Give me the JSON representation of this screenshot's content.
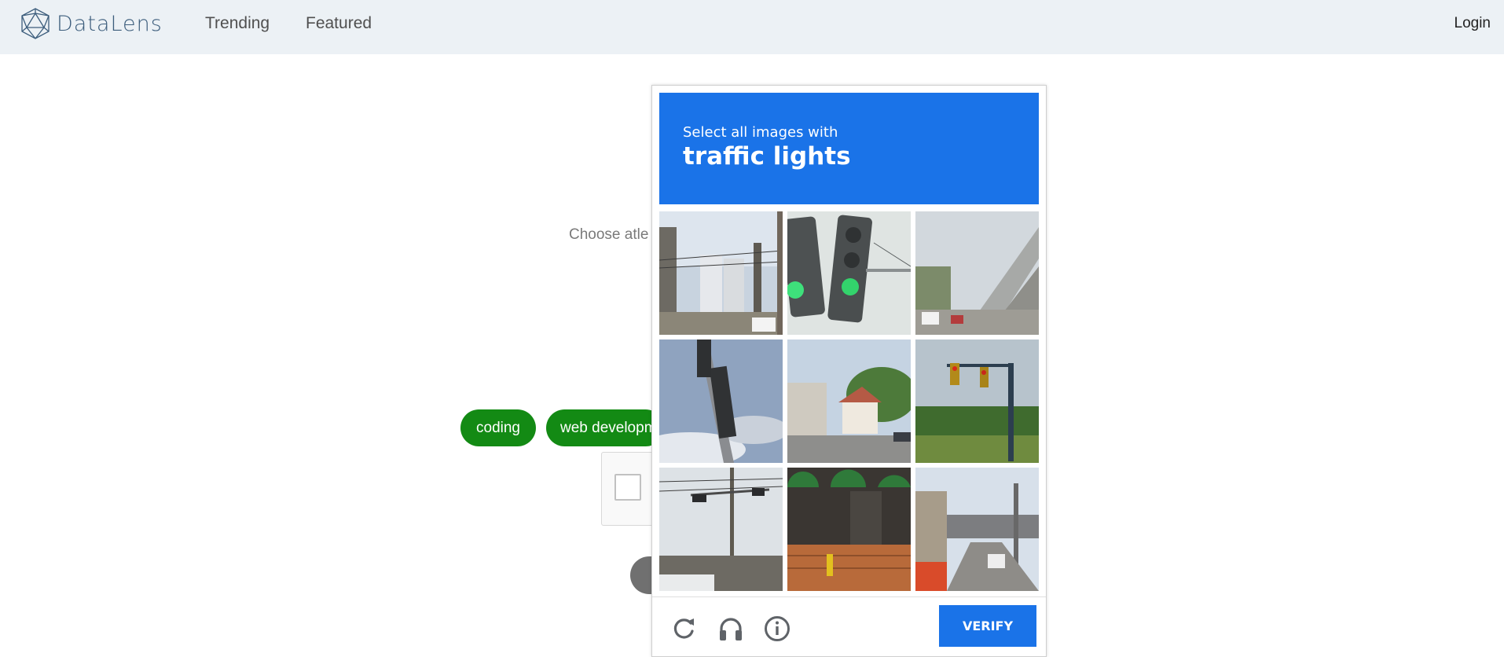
{
  "navbar": {
    "brand": "DataLens",
    "links": [
      "Trending",
      "Featured"
    ],
    "login": "Login"
  },
  "page": {
    "choose_text": "Choose atle",
    "tags": [
      "coding",
      "web developm"
    ]
  },
  "captcha": {
    "instruction": "Select all images with",
    "target": "traffic lights",
    "accent_color": "#1a73e8",
    "tiles": [
      {
        "description": "city street with tall buildings and power lines"
      },
      {
        "description": "two traffic lights with green signals"
      },
      {
        "description": "elevated highway over street"
      },
      {
        "description": "traffic light pole against sky"
      },
      {
        "description": "residential street with houses"
      },
      {
        "description": "traffic lights on mast arm over field"
      },
      {
        "description": "traffic lights over street intersection"
      },
      {
        "description": "building facade with fire hydrant"
      },
      {
        "description": "town street with cars and buildings"
      }
    ],
    "footer_icons": [
      "reload-icon",
      "headphones-icon",
      "info-icon"
    ],
    "verify_label": "VERIFY"
  }
}
